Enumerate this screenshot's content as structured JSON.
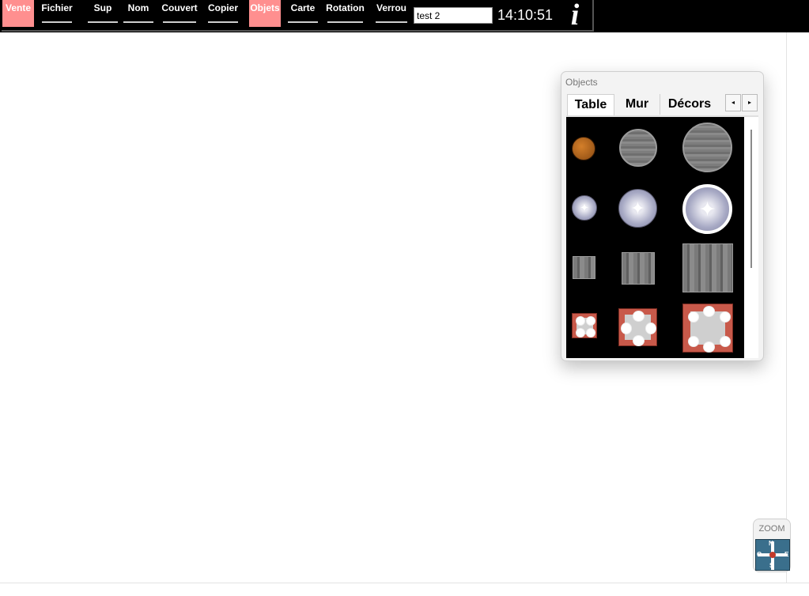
{
  "toolbar": {
    "buttons": [
      {
        "id": "vente",
        "label": "Vente",
        "active": true
      },
      {
        "id": "fichier",
        "label": "Fichier",
        "active": false
      },
      {
        "id": "sup",
        "label": "Sup",
        "active": false
      },
      {
        "id": "nom",
        "label": "Nom",
        "active": false
      },
      {
        "id": "couvert",
        "label": "Couvert",
        "active": false
      },
      {
        "id": "copier",
        "label": "Copier",
        "active": false
      },
      {
        "id": "objets",
        "label": "Objets",
        "active": true
      },
      {
        "id": "carte",
        "label": "Carte",
        "active": false
      },
      {
        "id": "rotation",
        "label": "Rotation",
        "active": false
      },
      {
        "id": "verrou",
        "label": "Verrou",
        "active": false
      }
    ],
    "name_input_value": "test 2",
    "clock": "14:10:51",
    "info_glyph": "i",
    "active_color": "#ff8f8f"
  },
  "objects_panel": {
    "title": "Objects",
    "tabs": [
      "Table",
      "Mur",
      "Décors"
    ],
    "selected_tab": "Table",
    "prev_arrow": "◂",
    "next_arrow": "▸",
    "items": [
      {
        "name": "round-table-wood-small",
        "icon": "round-wood-table-icon"
      },
      {
        "name": "round-table-grey-medium",
        "icon": "round-grey-table-icon"
      },
      {
        "name": "round-table-grey-large",
        "icon": "round-grey-table-icon"
      },
      {
        "name": "round-table-star-small",
        "icon": "round-star-table-icon"
      },
      {
        "name": "round-table-star-medium",
        "icon": "round-star-table-icon"
      },
      {
        "name": "round-table-star-chairs-large",
        "icon": "round-star-chairs-table-icon"
      },
      {
        "name": "square-table-grey-small",
        "icon": "square-grey-table-icon"
      },
      {
        "name": "square-table-grey-medium",
        "icon": "square-grey-table-icon"
      },
      {
        "name": "square-table-grey-large",
        "icon": "square-grey-table-icon"
      },
      {
        "name": "set-table-2-seats",
        "icon": "set-table-icon"
      },
      {
        "name": "set-table-4-seats",
        "icon": "set-table-icon"
      },
      {
        "name": "set-table-6-seats",
        "icon": "set-table-icon"
      }
    ]
  },
  "zoom": {
    "label": "ZOOM",
    "compass": {
      "n": "N",
      "s": "S",
      "e": "E",
      "o": "O"
    }
  }
}
